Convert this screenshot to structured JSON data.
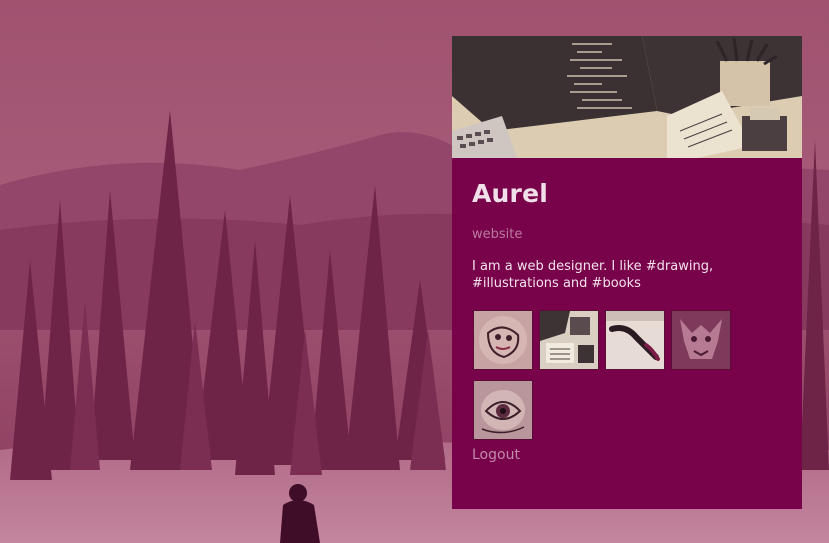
{
  "profile": {
    "name": "Aurel",
    "website_label": "website",
    "bio": "I am a web designer. I like #drawing, #illustrations and #books",
    "logout_label": "Logout"
  },
  "gallery": {
    "items": [
      {
        "icon": "sketch-face-thumbnail"
      },
      {
        "icon": "desk-supplies-thumbnail"
      },
      {
        "icon": "brush-stroke-thumbnail"
      },
      {
        "icon": "creature-drawing-thumbnail"
      },
      {
        "icon": "eye-sketch-thumbnail"
      }
    ]
  },
  "colors": {
    "background": "#9a4f6c",
    "card": "#79034b",
    "name_text": "#f1e0e9",
    "muted_text": "#b77b9d"
  }
}
